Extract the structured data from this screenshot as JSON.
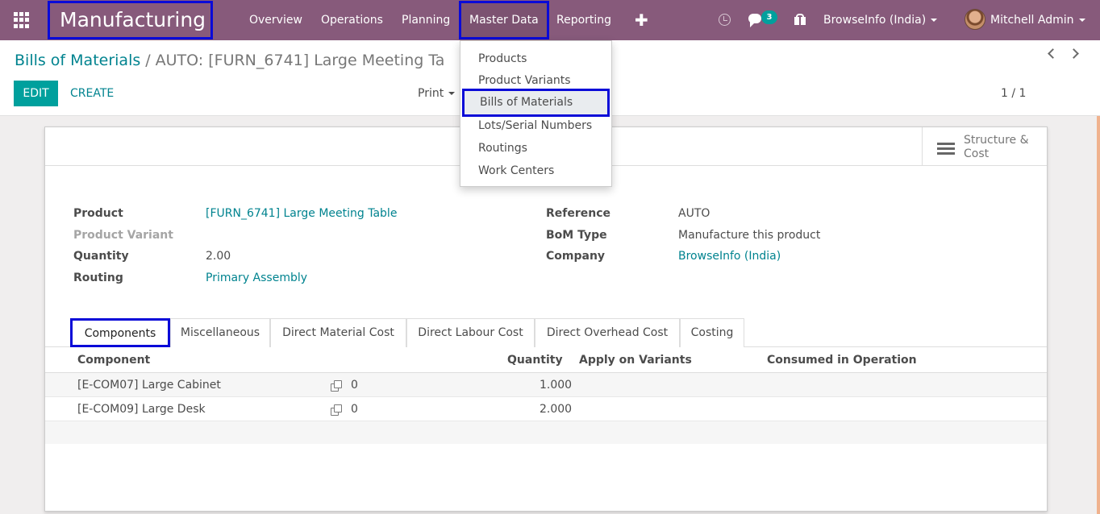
{
  "navbar": {
    "brand": "Manufacturing",
    "menu": [
      "Overview",
      "Operations",
      "Planning",
      "Master Data",
      "Reporting"
    ],
    "plus_label": "✚",
    "message_count": "3",
    "company": "BrowseInfo (India)",
    "user": "Mitchell Admin"
  },
  "master_data_menu": {
    "items": [
      "Products",
      "Product Variants",
      "Bills of Materials",
      "Lots/Serial Numbers",
      "Routings",
      "Work Centers"
    ]
  },
  "breadcrumb": {
    "parent": "Bills of Materials",
    "separator": "/",
    "current": "AUTO: [FURN_6741] Large Meeting Ta"
  },
  "toolbar": {
    "edit_label": "EDIT",
    "create_label": "CREATE",
    "print_label": "Print",
    "pager": "1 / 1"
  },
  "stat_button": {
    "label": "Structure & Cost"
  },
  "form": {
    "product_label": "Product",
    "product_value": "[FURN_6741] Large Meeting Table",
    "variant_label": "Product Variant",
    "variant_value": "",
    "quantity_label": "Quantity",
    "quantity_value": "2.00",
    "routing_label": "Routing",
    "routing_value": "Primary Assembly",
    "reference_label": "Reference",
    "reference_value": "AUTO",
    "bom_type_label": "BoM Type",
    "bom_type_value": "Manufacture this product",
    "company_label": "Company",
    "company_value": "BrowseInfo (India)"
  },
  "tabs": [
    "Components",
    "Miscellaneous",
    "Direct Material Cost",
    "Direct Labour Cost",
    "Direct Overhead Cost",
    "Costing"
  ],
  "components_table": {
    "columns": [
      "Component",
      "Quantity",
      "Apply on Variants",
      "Consumed in Operation"
    ],
    "rows": [
      {
        "component": "[E-COM07] Large Cabinet",
        "attachments": "0",
        "quantity": "1.000"
      },
      {
        "component": "[E-COM09] Large Desk",
        "attachments": "0",
        "quantity": "2.000"
      }
    ]
  },
  "colors": {
    "navbar": "#875a7b",
    "accent": "#00a09d",
    "link": "#00838f",
    "highlight_box": "#0a0ad8"
  }
}
